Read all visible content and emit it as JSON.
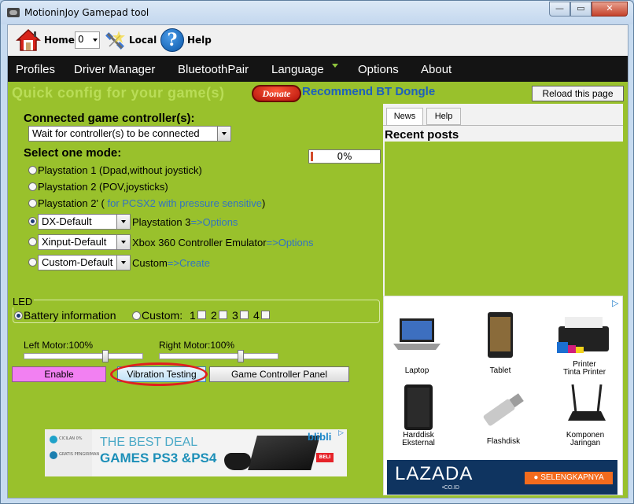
{
  "window": {
    "title": "MotioninJoy Gamepad tool",
    "min": "—",
    "max": "▭",
    "close": "✕"
  },
  "toolbar": {
    "home_label": "Home",
    "device_index": "0",
    "local_label": "Local",
    "help_label": "Help",
    "help_glyph": "?"
  },
  "menu": [
    "Profiles",
    "Driver Manager",
    "BluetoothPair",
    "Language",
    "Options",
    "About"
  ],
  "header": {
    "quick_config": "Quick config for your game(s)",
    "donate": "Donate",
    "bt_dongle": "Recommend BT Dongle",
    "reload": "Reload this page"
  },
  "controllers": {
    "heading": "Connected game controller(s):",
    "selected": "Wait for controller(s) to be connected",
    "progress_text": "0%",
    "progress": 0
  },
  "mode": {
    "heading": "Select one mode:",
    "ps1": "Playstation 1 (Dpad,without joystick)",
    "ps2": "Playstation 2 (POV,joysticks)",
    "ps2p_a": "Playstation 2' (",
    "ps2p_b": " for PCSX2 with pressure sensitive",
    "ps2p_c": ")",
    "ps3_select": "DX-Default",
    "ps3_a": "Playstation 3",
    "ps3_b": "=>Options",
    "x360_select": "Xinput-Default",
    "x360_a": "Xbox 360 Controller Emulator",
    "x360_b": "=>Options",
    "custom_select": "Custom-Default",
    "custom_a": "Custom",
    "custom_b": "=>Create"
  },
  "led": {
    "heading": "LED",
    "battery": "Battery information",
    "custom": "Custom:",
    "n1": "1",
    "n2": "2",
    "n3": "3",
    "n4": "4"
  },
  "motors": {
    "left": "Left Motor:100%",
    "right": "Right Motor:100%",
    "left_value": 100,
    "right_value": 100
  },
  "buttons": {
    "enable": "Enable",
    "vibration": "Vibration Testing",
    "panel": "Game Controller Panel"
  },
  "banner": {
    "line1": "THE BEST DEAL",
    "line2": "GAMES PS3 &PS4",
    "brand": "blibli",
    "cta": "BELI",
    "tiny1": "CICILAN 0%",
    "tiny2": "GRATIS PENGIRIMAN"
  },
  "news": {
    "tab_news": "News",
    "tab_help": "Help",
    "title": "Recent posts"
  },
  "ad": {
    "products": [
      "Laptop",
      "Tablet",
      "Printer\nTinta Printer",
      "Harddisk\nEksternal",
      "Flashdisk",
      "Komponen\nJaringan"
    ],
    "brand": "LAZADA",
    "brand_sub": "•CO.ID",
    "cta": "● SELENGKAPNYA"
  },
  "colors": {
    "bg_green": "#99c12c",
    "menubar": "#141414",
    "link_blue": "#3273c2",
    "enable_pink": "#f280f2",
    "highlight_red": "#e01f1f"
  }
}
